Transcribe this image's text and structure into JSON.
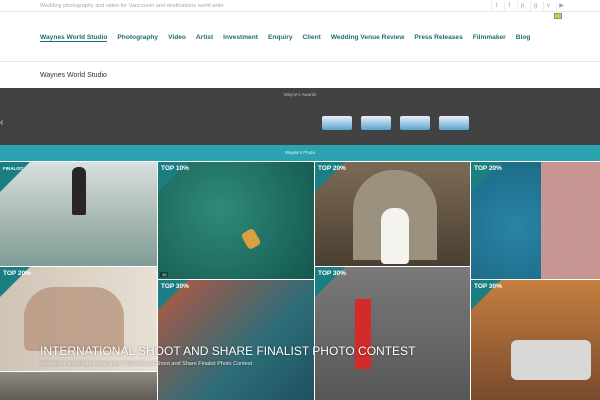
{
  "header": {
    "tagline": "Wedding photography and video for Vancouver and destinations world wide",
    "social_icons": [
      "twitter-icon",
      "facebook-icon",
      "pinterest-icon",
      "google-plus-icon",
      "vimeo-icon",
      "youtube-icon"
    ]
  },
  "nav": {
    "items": [
      "Waynes World Studio",
      "Photography",
      "Video",
      "Artist",
      "Investment",
      "Enquiry",
      "Client",
      "Wedding Venue Review",
      "Press Releases",
      "Filmmaker",
      "Blog"
    ]
  },
  "page": {
    "subtitle": "Waynes World Studio"
  },
  "badge_section": {
    "title": "Wayne's Awards"
  },
  "gallery_section": {
    "title": "Wayne's Photo"
  },
  "tiles": [
    {
      "label": "FINALIST",
      "count": ""
    },
    {
      "label": "TOP 10%",
      "count": "10"
    },
    {
      "label": "TOP 20%",
      "count": ""
    },
    {
      "label": "TOP 20%",
      "count": ""
    },
    {
      "label": "TOP 20%",
      "count": ""
    },
    {
      "label": "TOP 30%",
      "count": ""
    },
    {
      "label": "TOP 30%",
      "count": ""
    },
    {
      "label": "TOP 30%",
      "count": ""
    }
  ],
  "overlay": {
    "caption": "INTERNATIONAL SHOOT AND SHARE FINALIST PHOTO CONTEST",
    "subcaption": "Vancouver wedding photographer International Shoot and Share Finalist Photo Contest"
  },
  "colors": {
    "nav_text": "#1f6e72",
    "teal_bar": "#2ba3b1",
    "dark_bar": "#424242",
    "badge_triangle": "#1a7e83"
  }
}
